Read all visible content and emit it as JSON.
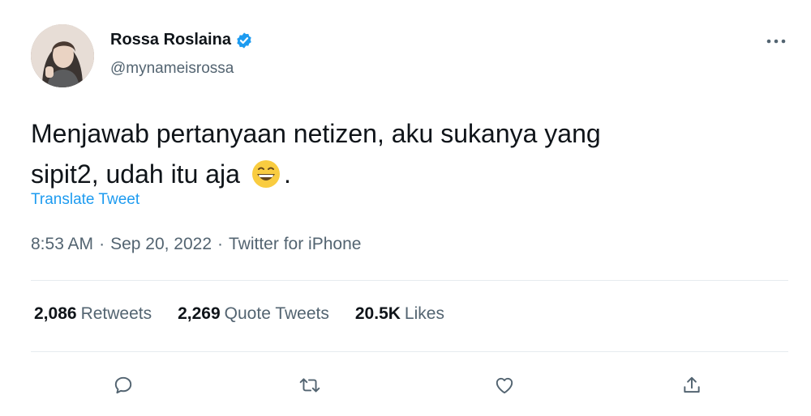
{
  "tweet": {
    "display_name": "Rossa Roslaina",
    "handle": "@mynameisrossa",
    "text_line1": "Menjawab pertanyaan netizen, aku sukanya yang",
    "text_line2": "sipit2, udah itu aja",
    "text_end": ".",
    "emoji": "grinning-face-icon",
    "translate_label": "Translate Tweet",
    "time": "8:53 AM",
    "separator": "·",
    "date": "Sep 20, 2022",
    "source": "Twitter for iPhone"
  },
  "stats": {
    "retweets_count": "2,086",
    "retweets_label": "Retweets",
    "quotes_count": "2,269",
    "quotes_label": "Quote Tweets",
    "likes_count": "20.5K",
    "likes_label": "Likes"
  },
  "colors": {
    "link": "#1d9bf0",
    "secondary_text": "#536471",
    "divider": "#e6ebef",
    "verified": "#1d9bf0"
  }
}
